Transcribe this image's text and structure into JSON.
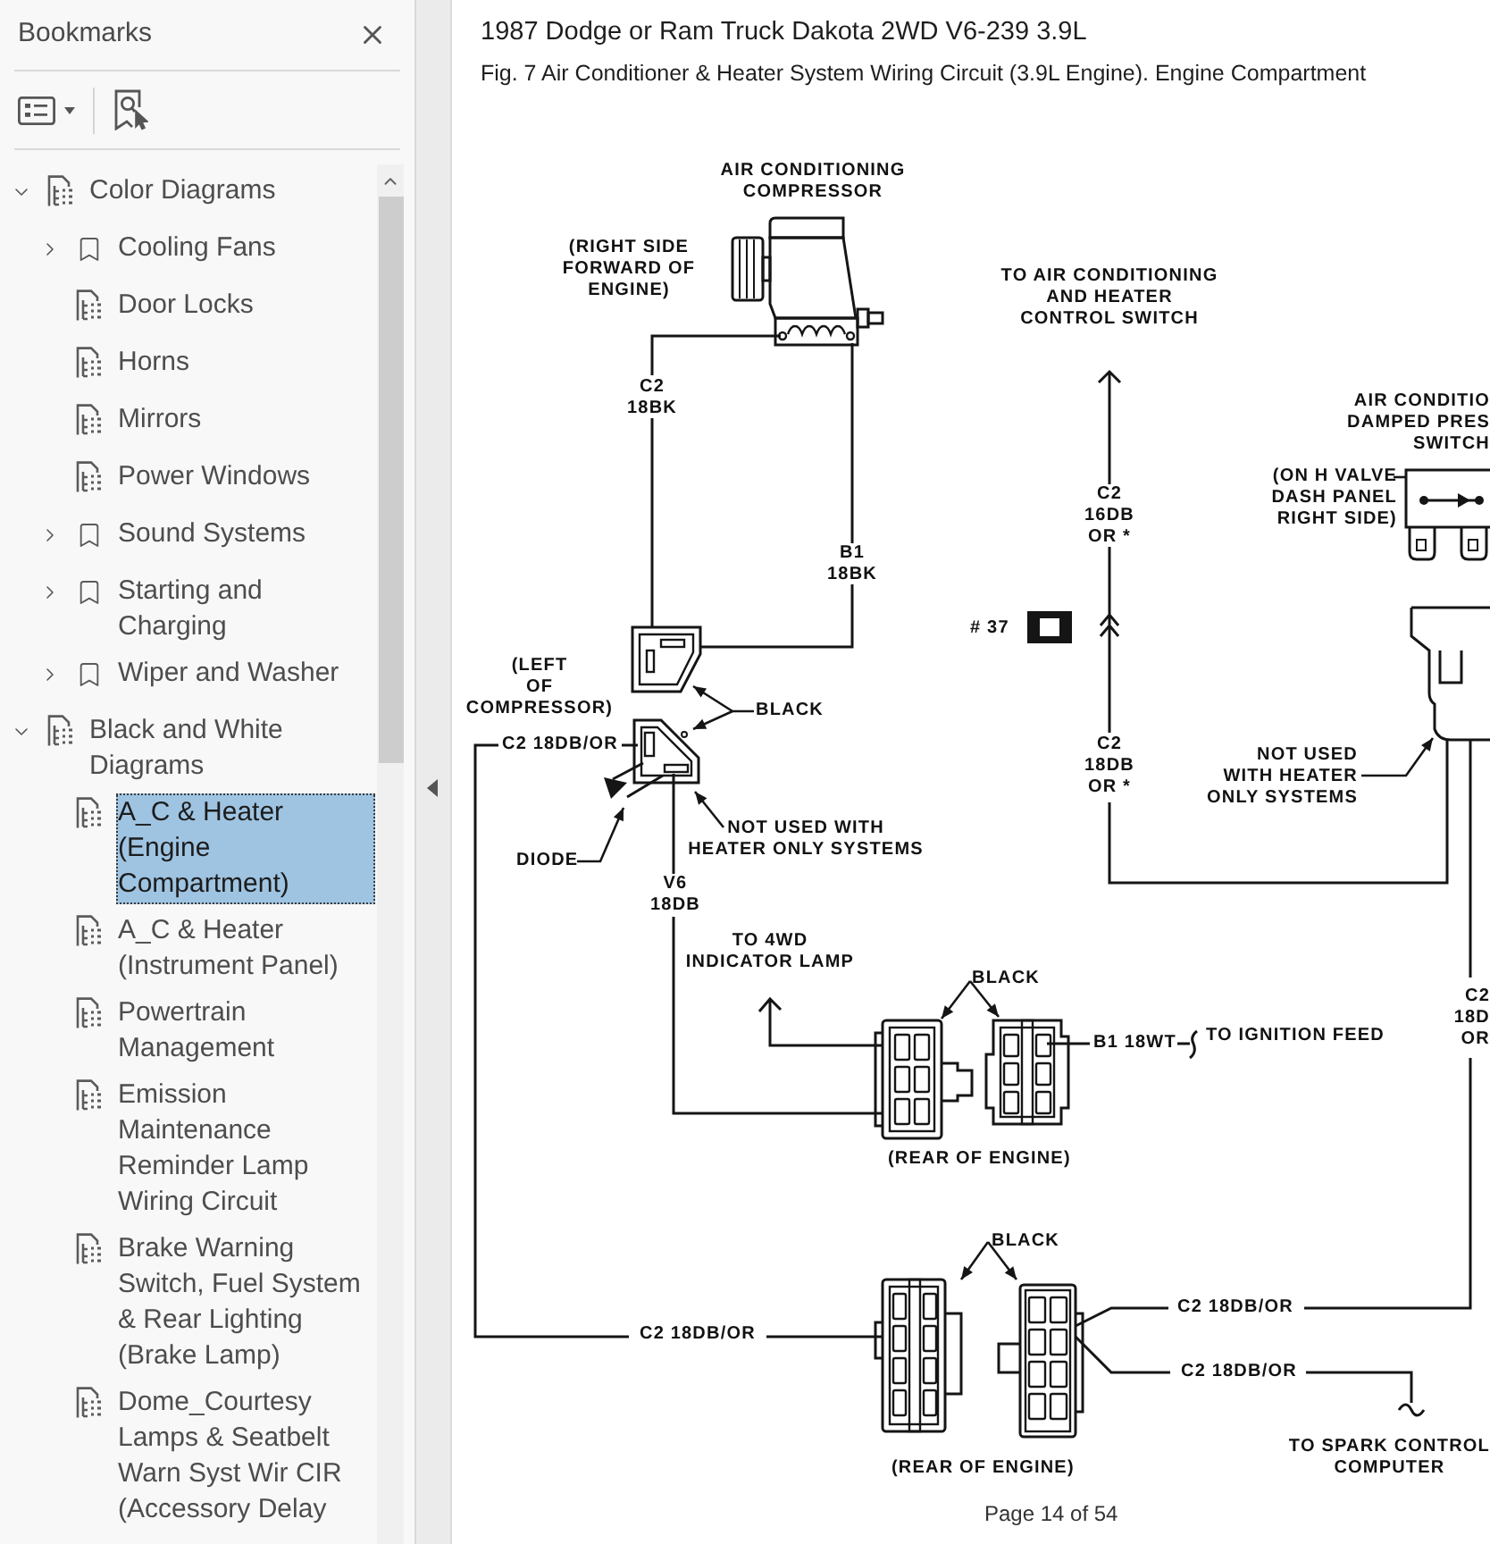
{
  "bookmarks_panel": {
    "title": "Bookmarks",
    "tree": [
      {
        "label": "Color Diagrams",
        "kind": "section",
        "expanded": true,
        "selected": false,
        "children": [
          {
            "label": "Cooling Fans",
            "kind": "group",
            "expanded": false,
            "selected": false
          },
          {
            "label": "Door Locks",
            "kind": "page",
            "selected": false
          },
          {
            "label": "Horns",
            "kind": "page",
            "selected": false
          },
          {
            "label": "Mirrors",
            "kind": "page",
            "selected": false
          },
          {
            "label": "Power Windows",
            "kind": "page",
            "selected": false
          },
          {
            "label": "Sound Systems",
            "kind": "group",
            "expanded": false,
            "selected": false
          },
          {
            "label": "Starting and Charging",
            "kind": "group",
            "expanded": false,
            "selected": false
          },
          {
            "label": "Wiper and Washer",
            "kind": "group",
            "expanded": false,
            "selected": false
          }
        ]
      },
      {
        "label": "Black and White Diagrams",
        "kind": "section",
        "expanded": true,
        "selected": false,
        "children": [
          {
            "label": "A_C & Heater (Engine Compartment)",
            "kind": "page",
            "selected": true
          },
          {
            "label": "A_C & Heater (Instrument Panel)",
            "kind": "page",
            "selected": false
          },
          {
            "label": "Powertrain Management",
            "kind": "page",
            "selected": false
          },
          {
            "label": "Emission Maintenance Reminder Lamp Wiring Circuit",
            "kind": "page",
            "selected": false
          },
          {
            "label": "Brake Warning Switch, Fuel System & Rear Lighting (Brake Lamp)",
            "kind": "page",
            "selected": false
          },
          {
            "label": "Dome_Courtesy Lamps & Seatbelt Warn Syst Wir CIR (Accessory Delay",
            "kind": "page",
            "selected": false
          }
        ]
      }
    ]
  },
  "document": {
    "title": "1987 Dodge or Ram Truck Dakota 2WD V6-239 3.9L",
    "caption": "Fig. 7 Air Conditioner & Heater System Wiring Circuit (3.9L Engine). Engine Compartment",
    "diagram": {
      "labels": [
        "AIR CONDITIONING\nCOMPRESSOR",
        "(RIGHT SIDE\nFORWARD OF\nENGINE)",
        "TO AIR CONDITIONING\nAND HEATER\nCONTROL SWITCH",
        "C2\n18BK",
        "AIR CONDITIO\nDAMPED PRES\nSWITCH",
        "(ON H VALVE\nDASH PANEL\nRIGHT SIDE)",
        "C2\n16DB\nOR *",
        "B1\n18BK",
        "# 37",
        "(LEFT\nOF\nCOMPRESSOR)",
        "BLACK",
        "C2 18DB/OR",
        "C2\n18DB\nOR *",
        "NOT USED\nWITH HEATER\nONLY SYSTEMS",
        "NOT USED WITH\nHEATER ONLY SYSTEMS",
        "DIODE",
        "V6\n18DB",
        "TO 4WD\nINDICATOR LAMP",
        "BLACK",
        "B1 18WT",
        "TO IGNITION FEED",
        "C2\n18D\nOR",
        "(REAR OF ENGINE)",
        "BLACK",
        "C2 18DB/OR",
        "C2 18DB/OR",
        "C2 18DB/OR",
        "(REAR OF ENGINE)",
        "TO SPARK CONTROL\nCOMPUTER"
      ]
    },
    "page_indicator": "Page 14 of 54"
  }
}
